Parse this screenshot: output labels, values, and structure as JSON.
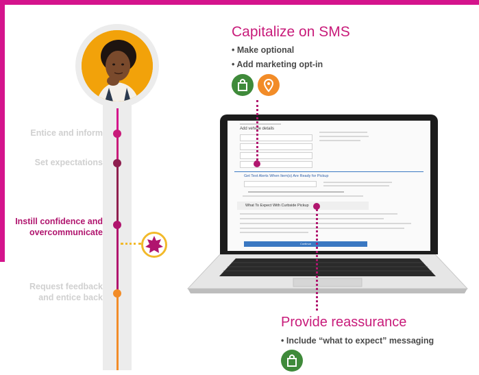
{
  "journey": {
    "stages": [
      {
        "label": "Entice and inform",
        "color": "#d8d8d8",
        "dot": "#c81b7a"
      },
      {
        "label": "Set expectations",
        "color": "#d8d8d8",
        "dot": "#8e1f4f"
      },
      {
        "label_line1": "Instill confidence and",
        "label_line2": "overcommunicate",
        "color": "#b0156e",
        "dot": "#b0156e"
      },
      {
        "label_line1": "Request feedback",
        "label_line2": "and entice back",
        "color": "#d8d8d8",
        "dot": "#f28c28"
      }
    ],
    "highlight_icon": "star-badge-icon"
  },
  "sms": {
    "title": "Capitalize on SMS",
    "bullets": [
      "• Make optional",
      "• Add marketing opt-in"
    ],
    "icons": [
      "shopping-bag-icon",
      "location-pin-icon"
    ],
    "icon_colors": [
      "#3f8a3a",
      "#f28c28"
    ]
  },
  "screen": {
    "vehicle_heading": "Add vehicle details",
    "alerts_heading": "Get Text Alerts When Item(s) Are Ready for Pickup",
    "expect_heading": "What To Expect With Curbside Pickup",
    "button_label": "Continue"
  },
  "reassure": {
    "title": "Provide reassurance",
    "bullets": [
      "• Include “what to expect” messaging"
    ],
    "icons": [
      "shopping-bag-icon"
    ],
    "icon_colors": [
      "#3f8a3a"
    ]
  },
  "colors": {
    "brand": "#c81b7a",
    "accent": "#d4148c",
    "orange": "#f28c28",
    "green": "#3f8a3a"
  }
}
